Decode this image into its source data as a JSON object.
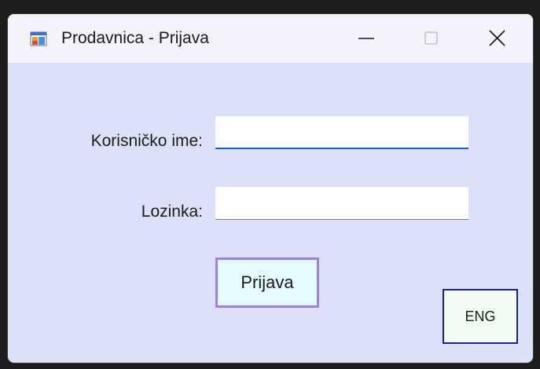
{
  "window": {
    "title": "Prodavnica - Prijava"
  },
  "titlebar_buttons": {
    "minimize_icon": "minimize-icon",
    "maximize_icon": "maximize-icon",
    "close_icon": "close-icon"
  },
  "form": {
    "username_label": "Korisničko ime:",
    "username_value": "",
    "password_label": "Lozinka:",
    "password_value": "",
    "login_button": "Prijava",
    "language_button": "ENG"
  },
  "colors": {
    "window_background": "#dde1f7",
    "titlebar_background": "#f3f4fb",
    "focused_field_underline": "#0a62c7",
    "login_button_border": "#9b82dd",
    "login_button_background": "#e6fbff",
    "language_button_border": "#1f1f8f",
    "language_button_background": "#f1fdf2"
  }
}
